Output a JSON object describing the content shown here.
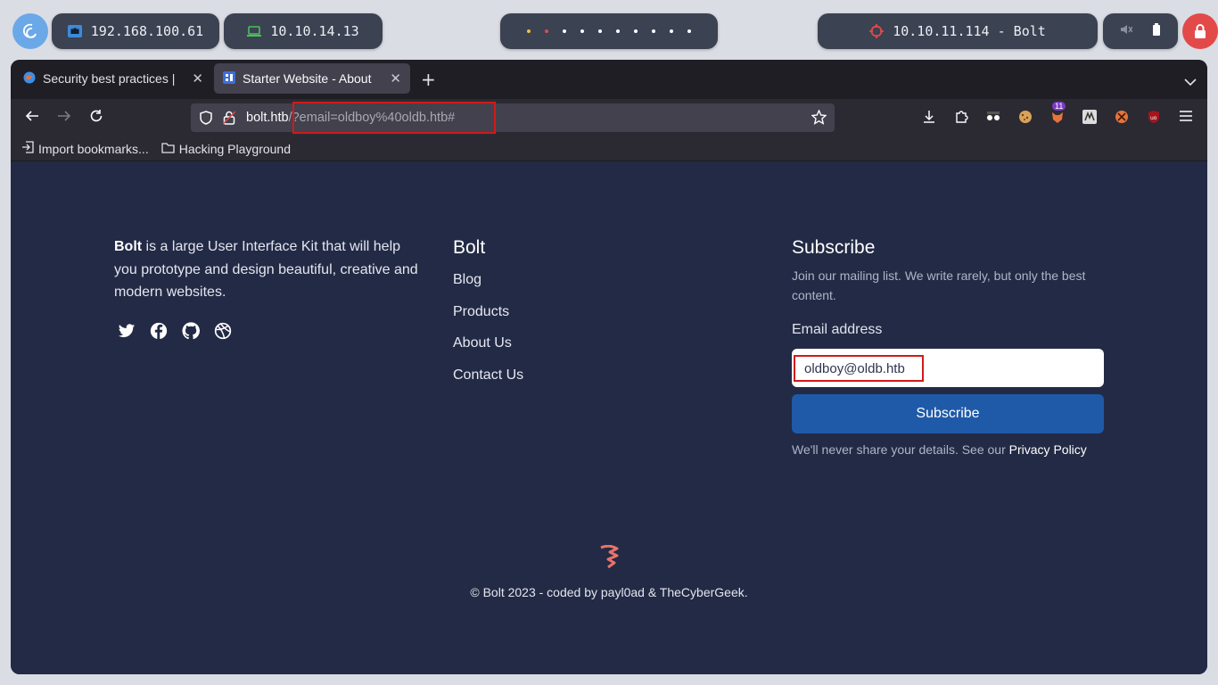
{
  "topbar": {
    "host_ip": "192.168.100.61",
    "vpn_ip": "10.10.14.13",
    "target": "10.10.11.114 - Bolt",
    "workspace_dot_colors": [
      "#f0c040",
      "#e24a4a",
      "#ffffff",
      "#ffffff",
      "#ffffff",
      "#ffffff",
      "#ffffff",
      "#ffffff",
      "#ffffff",
      "#ffffff"
    ]
  },
  "browser": {
    "tabs": [
      {
        "title": "Security best practices |",
        "icon": "globe-icon"
      },
      {
        "title": "Starter Website - About",
        "icon": "site-favicon"
      }
    ],
    "url": {
      "host": "bolt.htb",
      "rest": "/?email=oldboy%40oldb.htb#"
    },
    "extension_badge": "11",
    "bookmarks": [
      {
        "label": "Import bookmarks...",
        "icon": "import-icon"
      },
      {
        "label": "Hacking Playground",
        "icon": "folder-icon"
      }
    ]
  },
  "page": {
    "about": {
      "brand": "Bolt",
      "text": " is a large User Interface Kit that will help you prototype and design beautiful, creative and modern websites."
    },
    "social": [
      "twitter-icon",
      "facebook-icon",
      "github-icon",
      "dribbble-icon"
    ],
    "links_title": "Bolt",
    "links": [
      "Blog",
      "Products",
      "About Us",
      "Contact Us"
    ],
    "subscribe": {
      "title": "Subscribe",
      "description": "Join our mailing list. We write rarely, but only the best content.",
      "email_label": "Email address",
      "email_value": "oldboy@oldb.htb",
      "button": "Subscribe",
      "privacy_prefix": "We'll never share your details. See our ",
      "privacy_link": "Privacy Policy"
    },
    "copyright": "© Bolt 2023 - coded by payl0ad & TheCyberGeek."
  },
  "colors": {
    "page_bg": "#232a45",
    "button": "#1f5aa8",
    "highlight": "#d11a1a",
    "logo": "#e8736a"
  }
}
